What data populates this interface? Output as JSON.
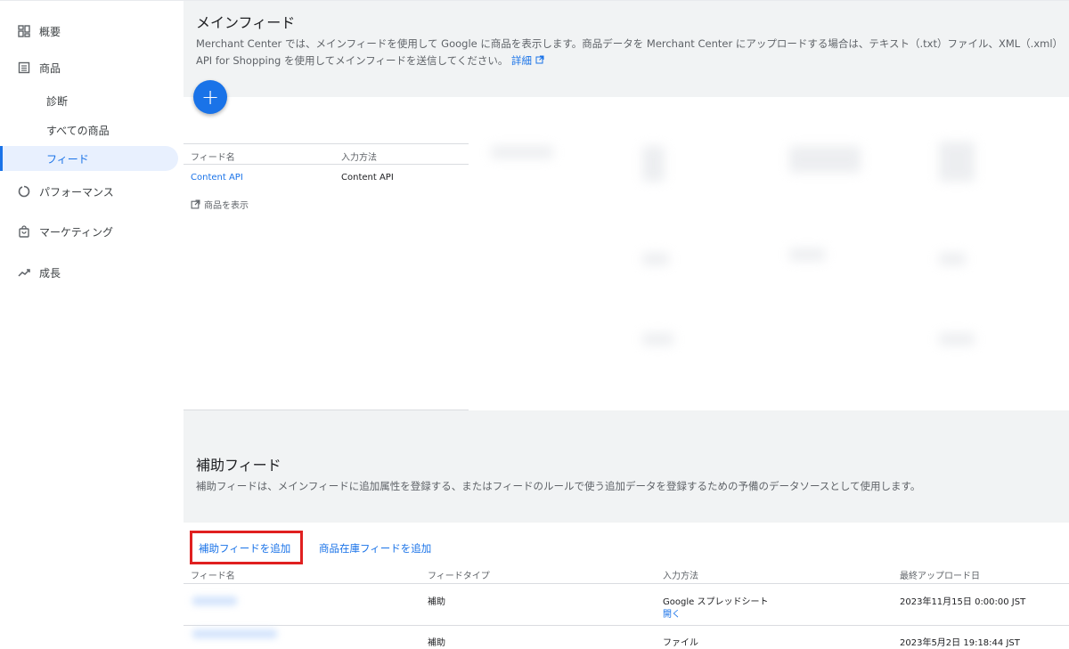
{
  "sidebar": {
    "items": [
      {
        "label": "概要",
        "icon": "dashboard-icon"
      },
      {
        "label": "商品",
        "icon": "list-icon"
      },
      {
        "label": "診断"
      },
      {
        "label": "すべての商品"
      },
      {
        "label": "フィード",
        "active": true
      },
      {
        "label": "パフォーマンス",
        "icon": "performance-icon"
      },
      {
        "label": "マーケティング",
        "icon": "shopping-bag-icon"
      },
      {
        "label": "成長",
        "icon": "trending-up-icon"
      }
    ]
  },
  "main_feed": {
    "title": "メインフィード",
    "description_line1": "Merchant Center では、メインフィードを使用して Google に商品を表示します。商品データを Merchant Center にアップロードする場合は、テキスト（.txt）ファイル、XML（.xml）",
    "description_line2": "API for Shopping を使用してメインフィードを送信してください。",
    "details_link": "詳細",
    "add_button": "+",
    "table": {
      "columns": [
        "フィード名",
        "入力方法"
      ],
      "rows": [
        {
          "name": "Content API",
          "method": "Content API"
        }
      ],
      "view_products": "商品を表示"
    }
  },
  "supplemental_feed": {
    "title": "補助フィード",
    "description": "補助フィードは、メインフィードに追加属性を登録する、またはフィードのルールで使う追加データを登録するための予備のデータソースとして使用します。",
    "add_supplemental_button": "補助フィードを追加",
    "add_inventory_button": "商品在庫フィードを追加",
    "table": {
      "columns": [
        "フィード名",
        "フィードタイプ",
        "入力方法",
        "最終アップロード日"
      ],
      "rows": [
        {
          "type": "補助",
          "method": "Google スプレッドシート",
          "open_link": "開く",
          "last_upload": "2023年11月15日 0:00:00 JST"
        },
        {
          "type": "補助",
          "method": "ファイル",
          "last_upload": "2023年5月2日 19:18:44 JST"
        }
      ]
    }
  },
  "colors": {
    "accent": "#1a73e8",
    "highlight_box": "#e02020",
    "background": "#f1f3f4"
  }
}
